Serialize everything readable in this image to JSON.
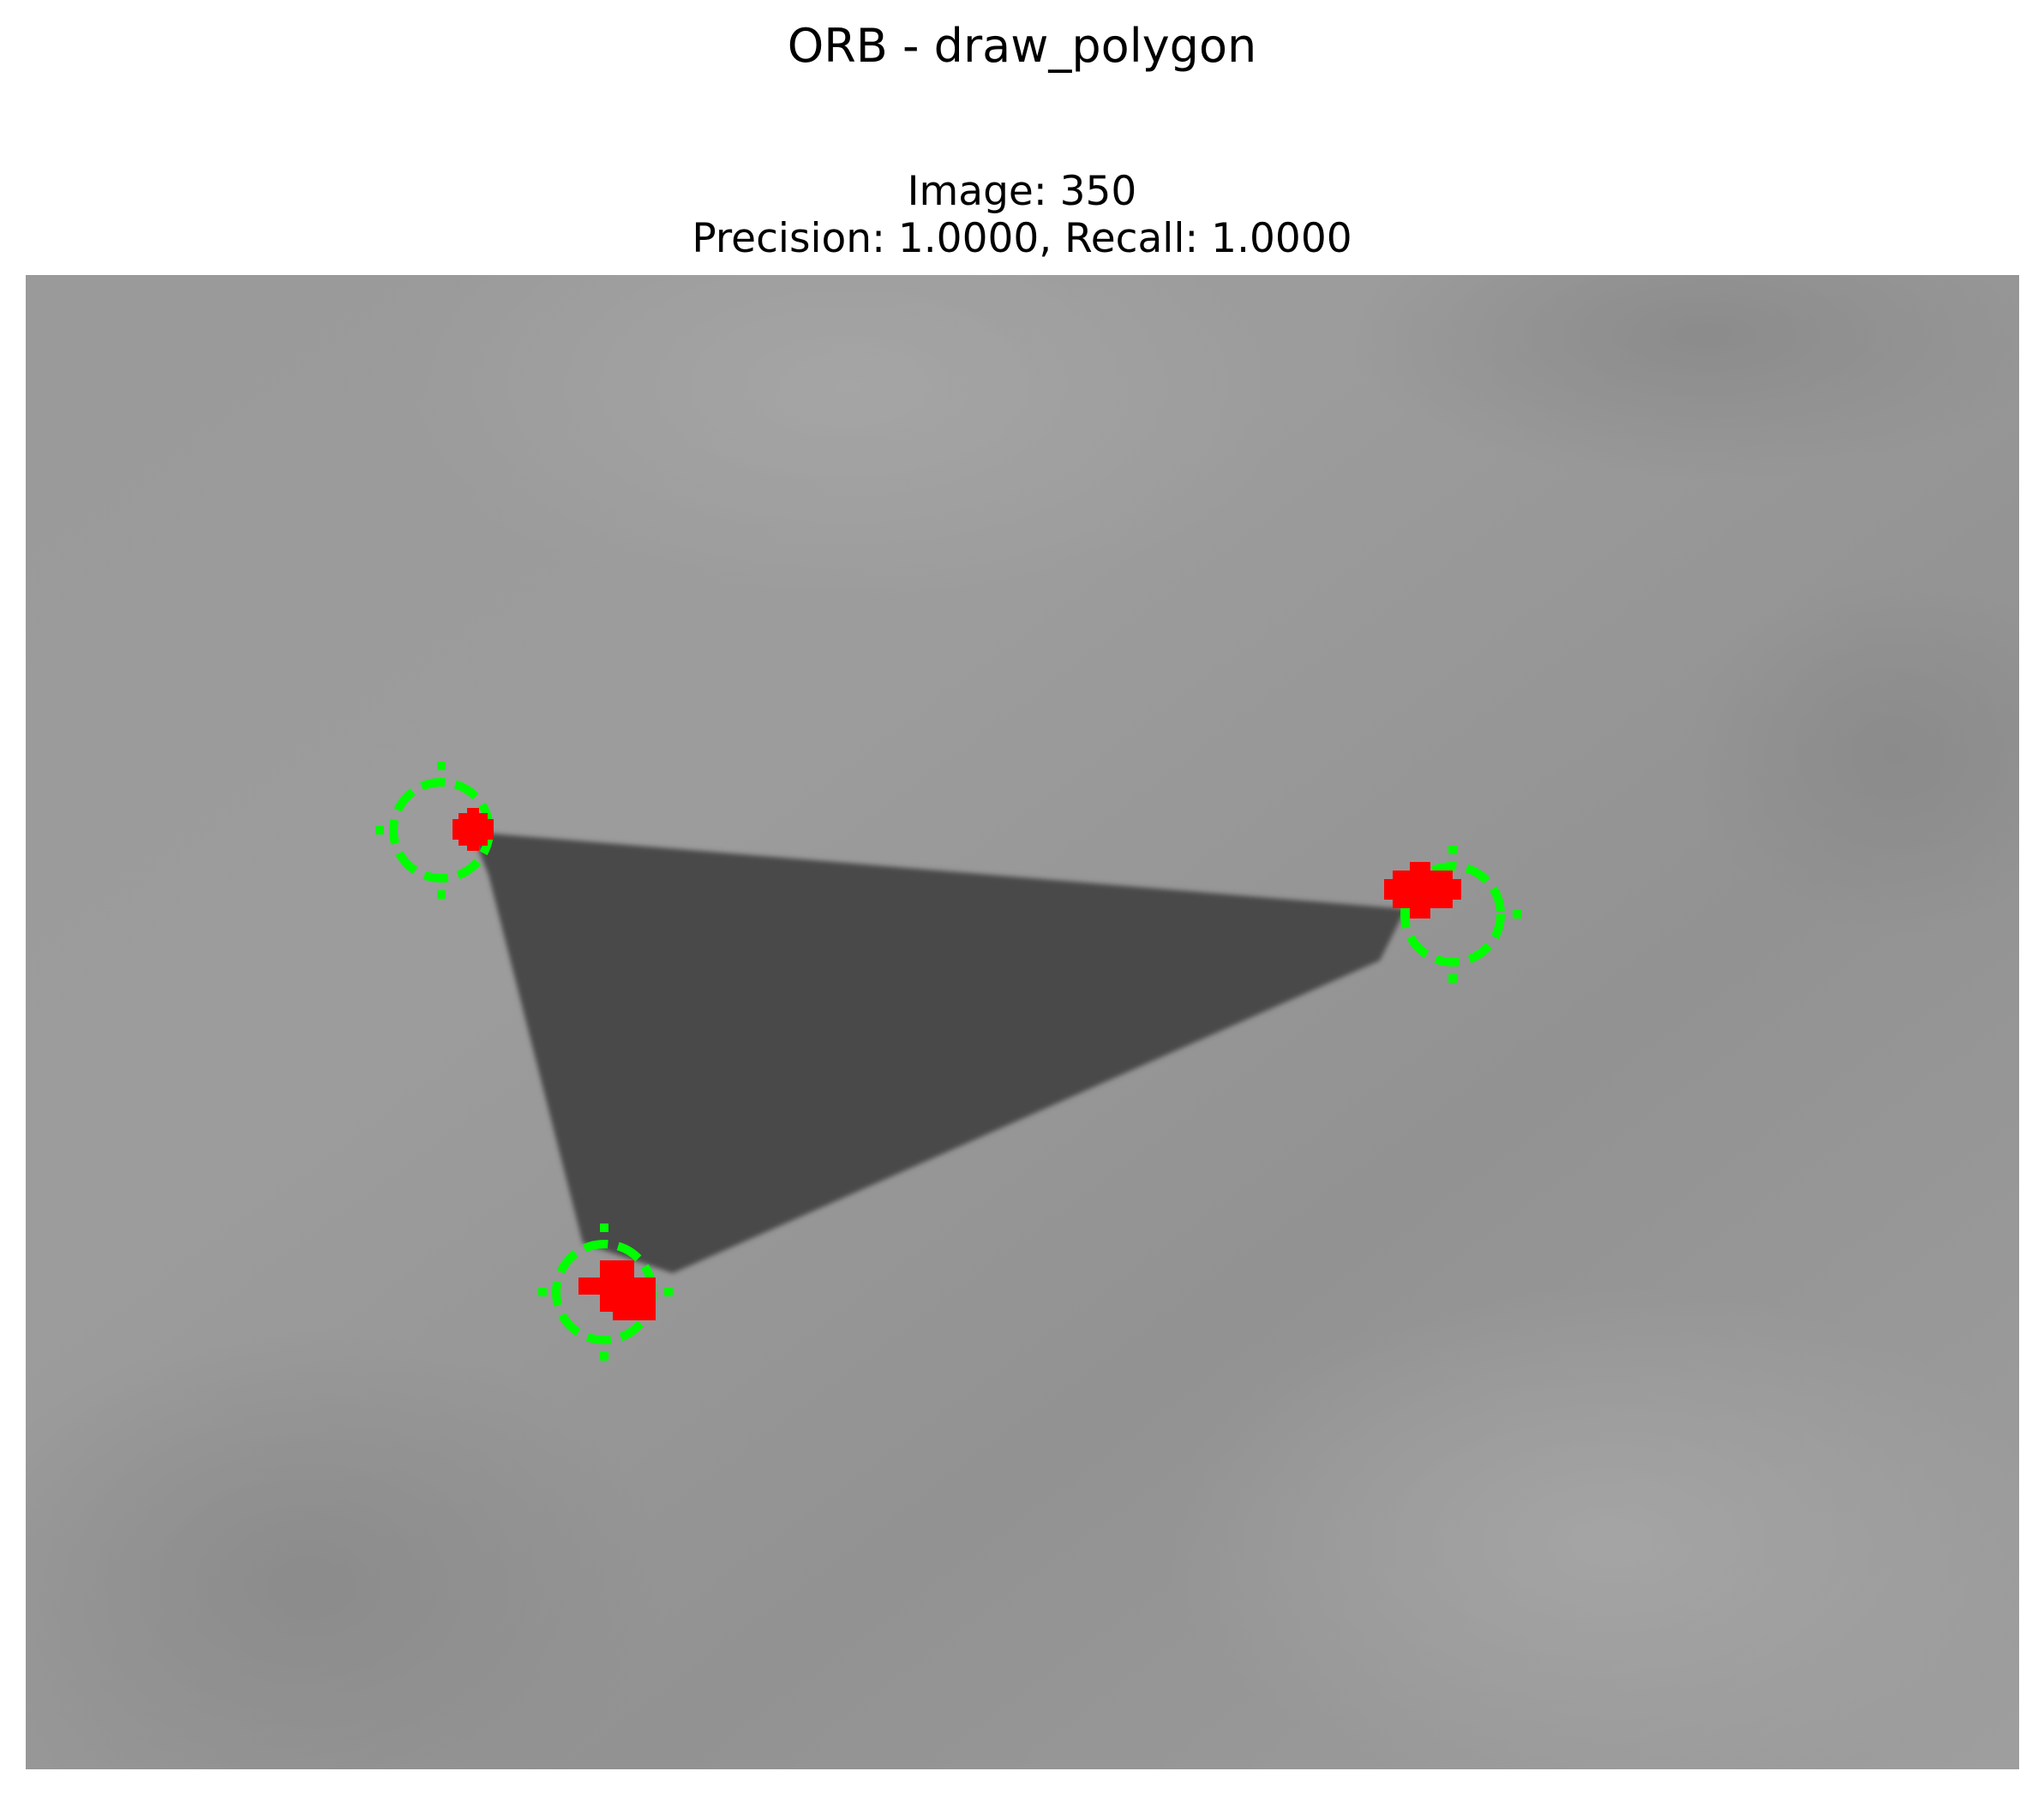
{
  "figure": {
    "title": "ORB - draw_polygon",
    "subtitle_line1": "Image: 350",
    "subtitle_line2": "Precision: 1.0000, Recall: 1.0000"
  },
  "colors": {
    "background_gray": "#969696",
    "polygon_fill": "#4a4a4a",
    "ground_truth_marker": "#00ff00",
    "detection_marker": "#ff0000"
  },
  "image": {
    "shape": "triangle",
    "axes_visible": false
  }
}
